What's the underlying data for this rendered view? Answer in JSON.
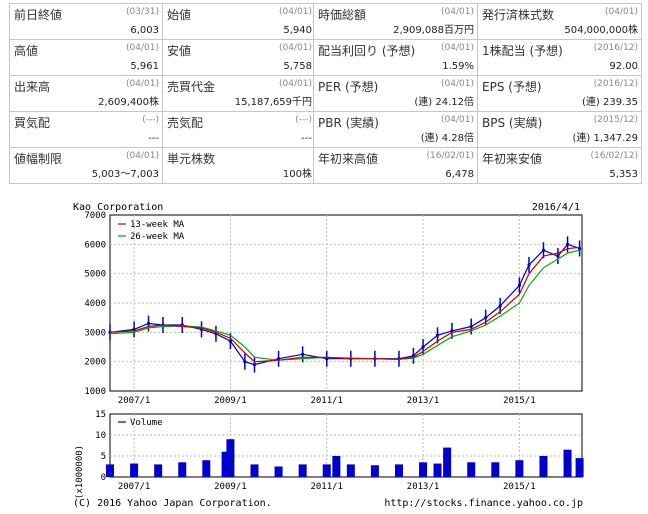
{
  "quote_left": [
    [
      {
        "label": "前日終値",
        "date": "(03/31)",
        "value": "6,003"
      },
      {
        "label": "始値",
        "date": "(04/01)",
        "value": "5,940"
      }
    ],
    [
      {
        "label": "高値",
        "date": "(04/01)",
        "value": "5,961"
      },
      {
        "label": "安値",
        "date": "(04/01)",
        "value": "5,758"
      }
    ],
    [
      {
        "label": "出来高",
        "date": "(04/01)",
        "value": "2,609,400株"
      },
      {
        "label": "売買代金",
        "date": "(04/01)",
        "value": "15,187,659千円"
      }
    ],
    [
      {
        "label": "買気配",
        "date": "(---)",
        "value": "---"
      },
      {
        "label": "売気配",
        "date": "(---)",
        "value": "---"
      }
    ],
    [
      {
        "label": "値幅制限",
        "date": "(04/01)",
        "value": "5,003～7,003"
      },
      {
        "label": "単元株数",
        "date": "",
        "value": "100株"
      }
    ]
  ],
  "quote_right": [
    [
      {
        "label": "時価総額",
        "date": "(04/01)",
        "value": "2,909,088百万円"
      },
      {
        "label": "発行済株式数",
        "date": "(04/01)",
        "value": "504,000,000株"
      }
    ],
    [
      {
        "label": "配当利回り (予想)",
        "date": "(04/01)",
        "value": "1.59%"
      },
      {
        "label": "1株配当 (予想)",
        "date": "(2016/12)",
        "value": "92.00"
      }
    ],
    [
      {
        "label": "PER (予想)",
        "date": "(04/01)",
        "value": "(連) 24.12倍"
      },
      {
        "label": "EPS (予想)",
        "date": "(2016/12)",
        "value": "(連) 239.35"
      }
    ],
    [
      {
        "label": "PBR (実績)",
        "date": "(04/01)",
        "value": "(連) 4.28倍"
      },
      {
        "label": "BPS (実績)",
        "date": "(2015/12)",
        "value": "(連) 1,347.29"
      }
    ],
    [
      {
        "label": "年初来高値",
        "date": "(16/02/01)",
        "value": "6,478"
      },
      {
        "label": "年初来安値",
        "date": "(16/02/12)",
        "value": "5,353"
      }
    ]
  ],
  "chart_data": {
    "type": "line",
    "title": "Kao Corporation",
    "date": "2016/4/1",
    "price_panel": {
      "ylim": [
        1000,
        7000
      ],
      "yticks": [
        1000,
        2000,
        3000,
        4000,
        5000,
        6000,
        7000
      ],
      "legend": [
        "13-week MA",
        "26-week MA"
      ],
      "colors": {
        "ma13": "#cc0000",
        "ma26": "#00aa00",
        "candle": "#0000cc"
      },
      "x": [
        2006.5,
        2007.0,
        2007.3,
        2007.6,
        2008.0,
        2008.4,
        2008.7,
        2009.0,
        2009.3,
        2009.5,
        2010.0,
        2010.5,
        2011.0,
        2011.5,
        2012.0,
        2012.5,
        2012.8,
        2013.0,
        2013.3,
        2013.6,
        2014.0,
        2014.3,
        2014.6,
        2015.0,
        2015.2,
        2015.5,
        2015.8,
        2016.0,
        2016.25
      ],
      "close": [
        3000,
        3100,
        3300,
        3250,
        3250,
        3100,
        2950,
        2700,
        2000,
        1900,
        2100,
        2250,
        2100,
        2100,
        2100,
        2100,
        2200,
        2500,
        2900,
        3050,
        3200,
        3500,
        3900,
        4600,
        5300,
        5800,
        5600,
        6000,
        5860
      ],
      "ma13": [
        3000,
        3050,
        3200,
        3250,
        3200,
        3150,
        3000,
        2800,
        2300,
        2000,
        2050,
        2150,
        2150,
        2100,
        2100,
        2080,
        2150,
        2350,
        2700,
        3000,
        3100,
        3350,
        3700,
        4300,
        5000,
        5600,
        5700,
        5850,
        5900
      ],
      "ma26": [
        2950,
        3000,
        3150,
        3200,
        3220,
        3180,
        3050,
        2900,
        2500,
        2150,
        2050,
        2100,
        2150,
        2120,
        2100,
        2080,
        2120,
        2250,
        2550,
        2850,
        3050,
        3250,
        3550,
        4000,
        4600,
        5200,
        5500,
        5700,
        5800
      ]
    },
    "volume_panel": {
      "ylim": [
        0,
        15
      ],
      "yticks": [
        0,
        5,
        10,
        15
      ],
      "ylabel": "(x1000000)",
      "legend": "Volume",
      "x": [
        2006.5,
        2007.0,
        2007.5,
        2008.0,
        2008.5,
        2008.9,
        2009.0,
        2009.5,
        2010.0,
        2010.5,
        2011.0,
        2011.2,
        2011.5,
        2012.0,
        2012.5,
        2013.0,
        2013.3,
        2013.5,
        2014.0,
        2014.5,
        2015.0,
        2015.5,
        2016.0,
        2016.25
      ],
      "values": [
        3,
        3.2,
        3,
        3.5,
        4,
        6,
        9,
        3,
        2.5,
        3,
        3,
        5,
        3,
        2.8,
        3,
        3.5,
        3.2,
        7,
        3.5,
        3.5,
        4,
        5,
        6.5,
        4.5
      ]
    },
    "x_ticks": [
      "2007/1",
      "2009/1",
      "2011/1",
      "2013/1",
      "2015/1"
    ],
    "x_tick_values": [
      2007.0,
      2009.0,
      2011.0,
      2013.0,
      2015.0
    ],
    "xlim": [
      2006.5,
      2016.3
    ]
  },
  "footer": {
    "copyright": "(C) 2016 Yahoo Japan Corporation.",
    "url": "http://stocks.finance.yahoo.co.jp"
  }
}
